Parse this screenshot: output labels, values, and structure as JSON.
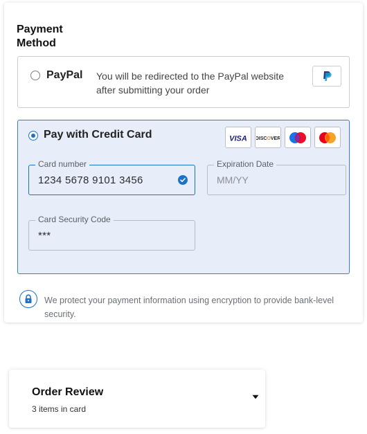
{
  "payment": {
    "title": "Payment Method",
    "paypal": {
      "label": "PayPal",
      "description": "You will be redirected to the PayPal website after submitting your order",
      "selected": false,
      "logo_icon": "paypal-logo-icon"
    },
    "credit_card": {
      "label": "Pay with Credit Card",
      "selected": true,
      "brands": [
        {
          "name": "VISA",
          "icon": "visa-logo-icon"
        },
        {
          "name": "DISCOVER",
          "icon": "discover-logo-icon"
        },
        {
          "name": "Maestro",
          "icon": "maestro-logo-icon"
        },
        {
          "name": "Mastercard",
          "icon": "mastercard-logo-icon"
        }
      ],
      "card_number": {
        "label": "Card number",
        "value": "1234 5678 9101 3456",
        "valid": true
      },
      "expiration": {
        "label": "Expiration Date",
        "placeholder": "MM/YY",
        "value": ""
      },
      "security_code": {
        "label": "Card Security Code",
        "value": "***"
      }
    },
    "security_note": "We protect your payment information using encryption to provide bank-level security."
  },
  "order_review": {
    "title": "Order Review",
    "subtitle": "3 items in card",
    "expand_icon": "caret-down-icon"
  },
  "colors": {
    "accent": "#1a73c9",
    "selected_bg": "#e8eef9",
    "border": "#c9ccd1"
  }
}
